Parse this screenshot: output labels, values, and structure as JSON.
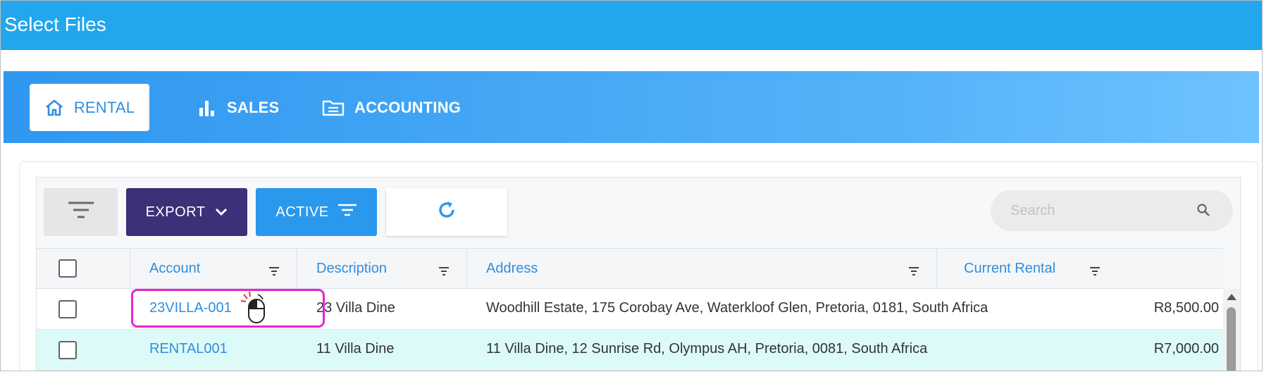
{
  "window": {
    "title": "Select Files"
  },
  "tabs": [
    {
      "label": "RENTAL",
      "icon": "home-icon",
      "active": true
    },
    {
      "label": "SALES",
      "icon": "bar-chart-icon",
      "active": false
    },
    {
      "label": "ACCOUNTING",
      "icon": "folder-icon",
      "active": false
    }
  ],
  "toolbar": {
    "export_label": "EXPORT",
    "active_label": "ACTIVE",
    "search_placeholder": "Search"
  },
  "table": {
    "columns": [
      "Account",
      "Description",
      "Address",
      "Current Rental"
    ],
    "rows": [
      {
        "account": "23VILLA-001",
        "description": "23 Villa Dine",
        "address": "Woodhill Estate, 175 Corobay Ave, Waterkloof Glen, Pretoria, 0181, South Africa",
        "current_rental": "R8,500.00"
      },
      {
        "account": "RENTAL001",
        "description": "11 Villa Dine",
        "address": "11 Villa Dine, 12 Sunrise Rd, Olympus AH, Pretoria, 0081, South Africa",
        "current_rental": "R7,000.00"
      }
    ]
  },
  "colors": {
    "title_bar": "#22a7ec",
    "export_button": "#3d2f78",
    "active_button": "#2a98ec",
    "link": "#2e8fe0",
    "highlight": "#e824d1",
    "alt_row": "#dcfaf8"
  }
}
